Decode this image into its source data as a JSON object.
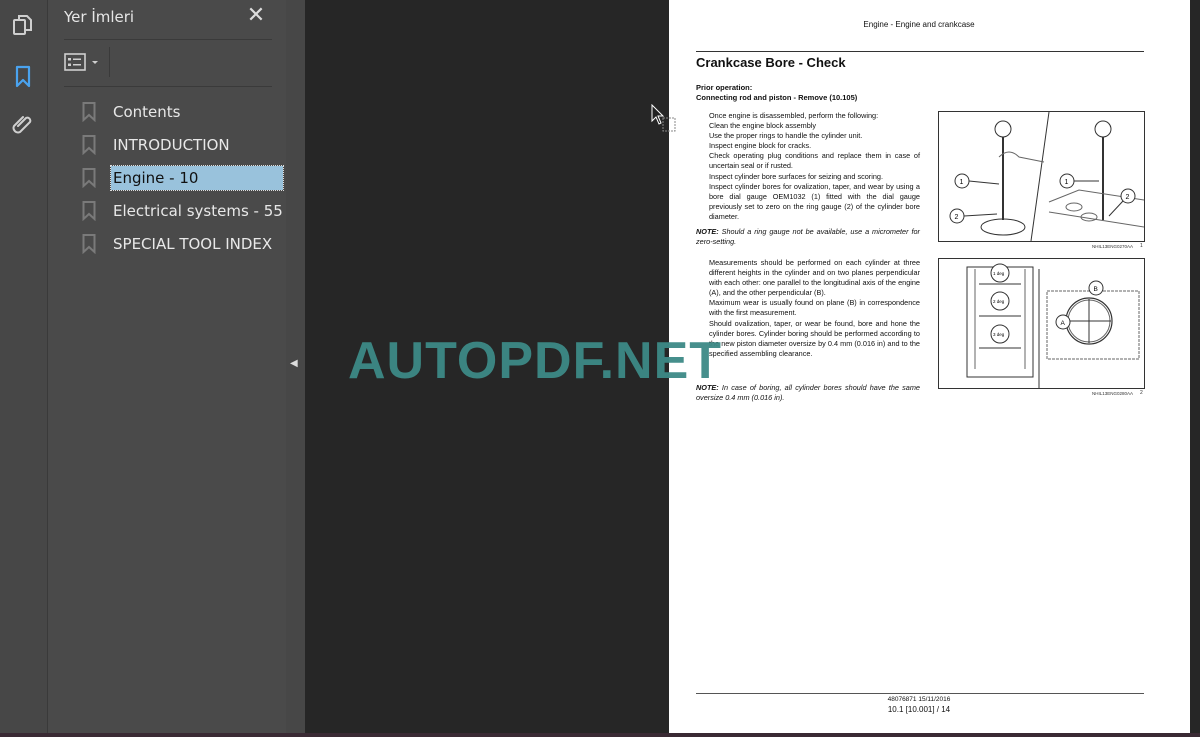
{
  "left_rail": {
    "items": [
      {
        "name": "pages-thumbnail",
        "icon": "pages-icon"
      },
      {
        "name": "bookmarks",
        "icon": "bookmark-icon",
        "active": true
      },
      {
        "name": "attachments",
        "icon": "paperclip-icon"
      }
    ]
  },
  "bookmarks_panel": {
    "title": "Yer İmleri",
    "close_icon": "close-icon",
    "options_icon": "bookmark-options-icon",
    "items": [
      {
        "label": "Contents",
        "selected": false
      },
      {
        "label": "INTRODUCTION",
        "selected": false
      },
      {
        "label": "Engine - 10",
        "selected": true
      },
      {
        "label": "Electrical systems - 55",
        "selected": false
      },
      {
        "label": "SPECIAL TOOL INDEX",
        "selected": false
      }
    ]
  },
  "colors": {
    "selection": "#99c2dc",
    "active_icon": "#4aa3ef",
    "watermark": "#3d8a86"
  },
  "watermark": "AUTOPDF.NET",
  "document": {
    "running_header": "Engine - Engine and crankcase",
    "title": "Crankcase Bore - Check",
    "prior_label": "Prior operation:",
    "prior_value": "Connecting rod and piston - Remove (10.105)",
    "steps1": [
      "Once engine is disassembled, perform the following:",
      "Clean the engine block assembly",
      "Use the proper rings to handle the cylinder unit.",
      "Inspect engine block for cracks.",
      "Check operating plug conditions and replace them in case of uncertain seal or if rusted.",
      "Inspect cylinder bore surfaces for seizing and scoring.",
      "Inspect cylinder bores for ovalization, taper, and wear by using a bore dial gauge OEM1032 (1) fitted with the dial gauge previously set to zero on the ring gauge (2) of the cylinder bore diameter."
    ],
    "note1_label": "NOTE:",
    "note1": "Should a ring gauge not be available, use a micrometer for zero-setting.",
    "steps2": [
      "Measurements should be performed on each cylinder at three different heights in the cylinder and on two planes perpendicular with each other: one parallel to the longitudinal axis of the engine (A), and the other perpendicular (B).",
      "Maximum wear is usually found on plane (B) in correspondence with the first measurement.",
      "Should ovalization, taper, or wear be found, bore and hone the cylinder bores. Cylinder boring should be performed according to the new piston diameter oversize by 0.4 mm (0.016 in) and to the specified assembling clearance."
    ],
    "note2_label": "NOTE:",
    "note2": "In case of boring, all cylinder bores should have the same oversize 0.4 mm (0.016 in).",
    "figure1": {
      "caption": "NHIL13ENG0270AA",
      "number": "1",
      "callouts": [
        "1",
        "2",
        "1",
        "2"
      ]
    },
    "figure2": {
      "caption": "NHIL13ENG0280AA",
      "number": "2",
      "callouts": [
        "1 deg",
        "2 deg",
        "3 deg",
        "A",
        "B"
      ]
    },
    "footer_doc": "48076871 15/11/2016",
    "footer_page": "10.1 [10.001] / 14"
  }
}
